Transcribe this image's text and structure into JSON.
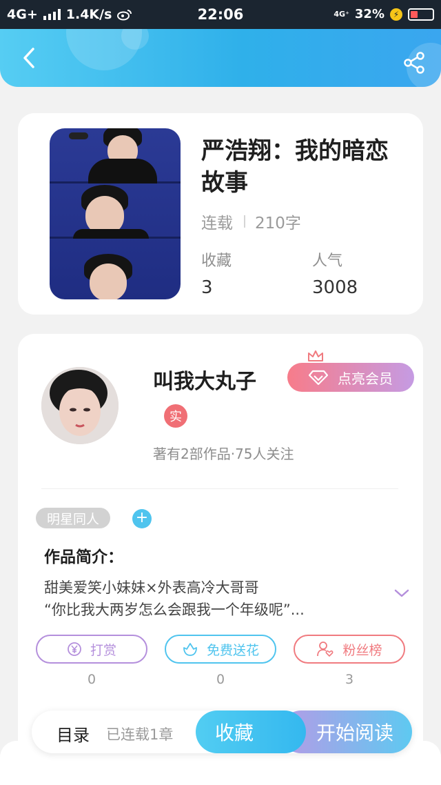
{
  "status_bar": {
    "network": "4G+",
    "speed": "1.4K/s",
    "time": "22:06",
    "network_right": "4G⁺",
    "battery": "32%"
  },
  "header": {
    "back_icon": "chevron-left-icon",
    "share_icon": "share-icon",
    "accent_color": "#2fb0ea"
  },
  "book": {
    "title": "严浩翔：我的暗恋故事",
    "status": "连载",
    "word_count": "210字",
    "favorites_label": "收藏",
    "favorites_value": "3",
    "popularity_label": "人气",
    "popularity_value": "3008"
  },
  "author": {
    "name": "叫我大丸子",
    "verified_badge": "实",
    "info": "著有2部作品·75人关注",
    "vip_button": "点亮会员"
  },
  "tags": {
    "items": [
      "明星同人"
    ],
    "add_label": "+"
  },
  "intro": {
    "heading": "作品简介：",
    "line1": "甜美爱笑小妹妹×外表高冷大哥哥",
    "line2": "“你比我大两岁怎么会跟我一个年级呢”..."
  },
  "actions": [
    {
      "label": "打赏",
      "count": "0",
      "icon": "yen-icon",
      "color": "#b48fdc"
    },
    {
      "label": "免费送花",
      "count": "0",
      "icon": "flower-icon",
      "color": "#4fc4ee"
    },
    {
      "label": "粉丝榜",
      "count": "3",
      "icon": "fans-icon",
      "color": "#f07a7f"
    }
  ],
  "bottom_bar": {
    "toc_label": "目录",
    "chapter_count": "已连载1章",
    "collect_label": "收藏",
    "read_label": "开始阅读"
  }
}
